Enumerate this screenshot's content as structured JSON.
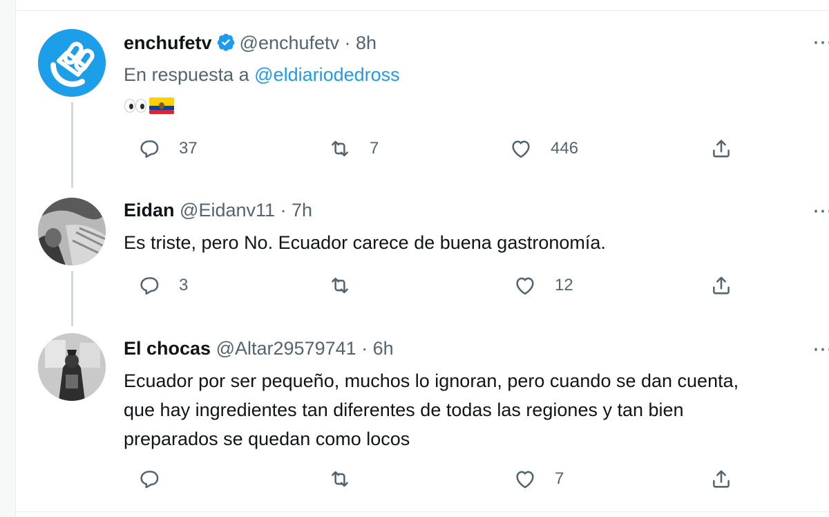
{
  "tweets": [
    {
      "name": "enchufetv",
      "handle": "@enchufetv",
      "time": "· 8h",
      "verified": true,
      "reply_prefix": "En respuesta a",
      "reply_handle": "@eldiariodedross",
      "text": "",
      "emojis": [
        "eyes-emoji",
        "ecuador-flag-emoji"
      ],
      "replies": "37",
      "retweets": "7",
      "likes": "446"
    },
    {
      "name": "Eidan",
      "handle": "@Eidanv11",
      "time": "· 7h",
      "text": "Es triste, pero No. Ecuador carece de buena gastronomía.",
      "replies": "3",
      "retweets": "",
      "likes": "12"
    },
    {
      "name": "El chocas",
      "handle": "@Altar29579741",
      "time": "· 6h",
      "text_lines": [
        "Ecuador por ser pequeño, muchos lo ignoran, pero cuando se dan cuenta,",
        "que hay ingredientes tan diferentes de todas las regiones y tan bien",
        "preparados se quedan como locos"
      ],
      "replies": "",
      "retweets": "",
      "likes": "7"
    }
  ],
  "colors": {
    "accent": "#1d9bf0",
    "secondary_text": "#536471",
    "thread_line": "#cfd9de"
  },
  "icons": [
    "reply-icon",
    "retweet-icon",
    "like-icon",
    "share-icon",
    "more-icon",
    "verified-icon"
  ]
}
